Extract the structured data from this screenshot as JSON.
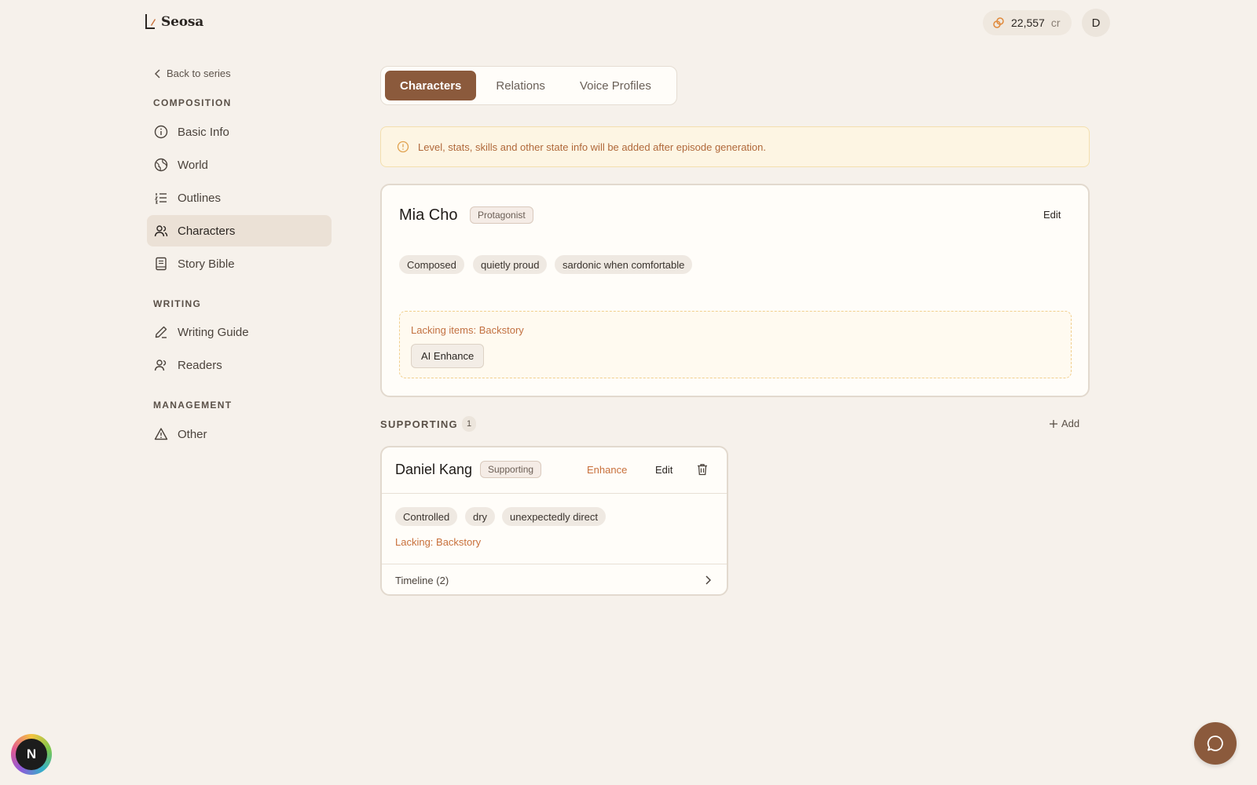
{
  "brand": {
    "name": "Seosa"
  },
  "credits": {
    "amount": "22,557",
    "unit": "cr"
  },
  "user": {
    "initial": "D"
  },
  "sidebar": {
    "back_label": "Back to series",
    "sections": [
      {
        "label": "COMPOSITION",
        "items": [
          {
            "label": "Basic Info",
            "icon": "info-icon"
          },
          {
            "label": "World",
            "icon": "globe-icon"
          },
          {
            "label": "Outlines",
            "icon": "list-icon"
          },
          {
            "label": "Characters",
            "icon": "users-icon",
            "active": true
          },
          {
            "label": "Story Bible",
            "icon": "book-icon"
          }
        ]
      },
      {
        "label": "WRITING",
        "items": [
          {
            "label": "Writing Guide",
            "icon": "pen-icon"
          },
          {
            "label": "Readers",
            "icon": "readers-icon"
          }
        ]
      },
      {
        "label": "MANAGEMENT",
        "items": [
          {
            "label": "Other",
            "icon": "warning-icon"
          }
        ]
      }
    ]
  },
  "tabs": [
    {
      "label": "Characters",
      "active": true
    },
    {
      "label": "Relations"
    },
    {
      "label": "Voice Profiles"
    }
  ],
  "notice": "Level, stats, skills and other state info will be added after episode generation.",
  "protagonist": {
    "name": "Mia Cho",
    "role": "Protagonist",
    "edit_label": "Edit",
    "traits": [
      "Composed",
      "quietly proud",
      "sardonic when comfortable"
    ],
    "lacking": "Lacking items: Backstory",
    "enhance_label": "AI Enhance"
  },
  "supporting": {
    "label": "SUPPORTING",
    "count": "1",
    "add_label": "Add",
    "characters": [
      {
        "name": "Daniel Kang",
        "role": "Supporting",
        "enhance_label": "Enhance",
        "edit_label": "Edit",
        "traits": [
          "Controlled",
          "dry",
          "unexpectedly direct"
        ],
        "lacking": "Lacking: Backstory",
        "timeline": "Timeline (2)"
      }
    ]
  },
  "floating": {
    "badge_letter": "N"
  },
  "colors": {
    "accent": "#8b5a3c",
    "background": "#f6f1eb",
    "warning": "#c8703b"
  }
}
